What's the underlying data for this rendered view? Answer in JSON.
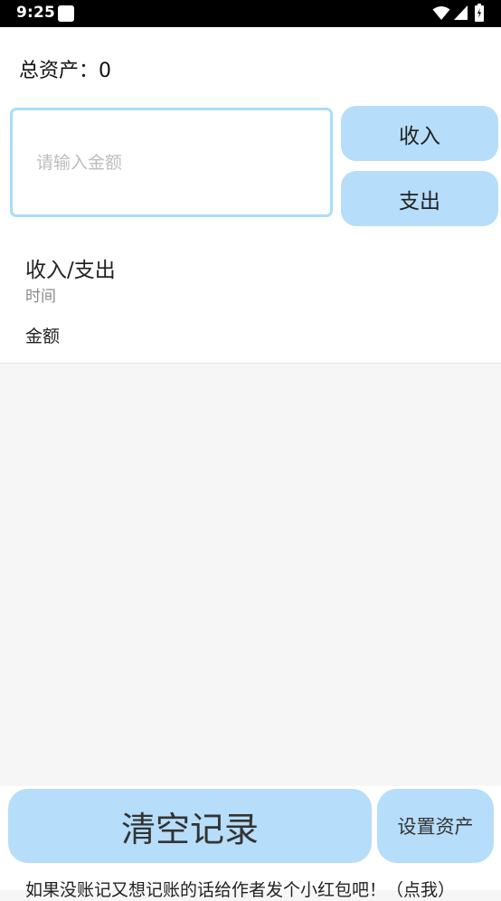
{
  "status_bar": {
    "time": "9:25"
  },
  "summary": {
    "total_assets_label": "总资产：0"
  },
  "entry": {
    "amount_placeholder": "请输入金额",
    "income_button": "收入",
    "expense_button": "支出"
  },
  "list_header": {
    "type_label": "收入/支出",
    "time_label": "时间",
    "amount_label": "金额"
  },
  "actions": {
    "clear_records": "清空记录",
    "set_assets": "设置资产"
  },
  "footer": {
    "donate_text": "如果没账记又想记账的话给作者发个小红包吧！（点我）"
  },
  "colors": {
    "button_bg": "#b6ddfa",
    "input_border": "#a9ddf6",
    "status_bar_bg": "#000000",
    "list_bg": "#f6f6f6"
  },
  "icons": [
    "app-notification-icon",
    "wifi-icon",
    "cell-signal-icon",
    "battery-icon"
  ]
}
